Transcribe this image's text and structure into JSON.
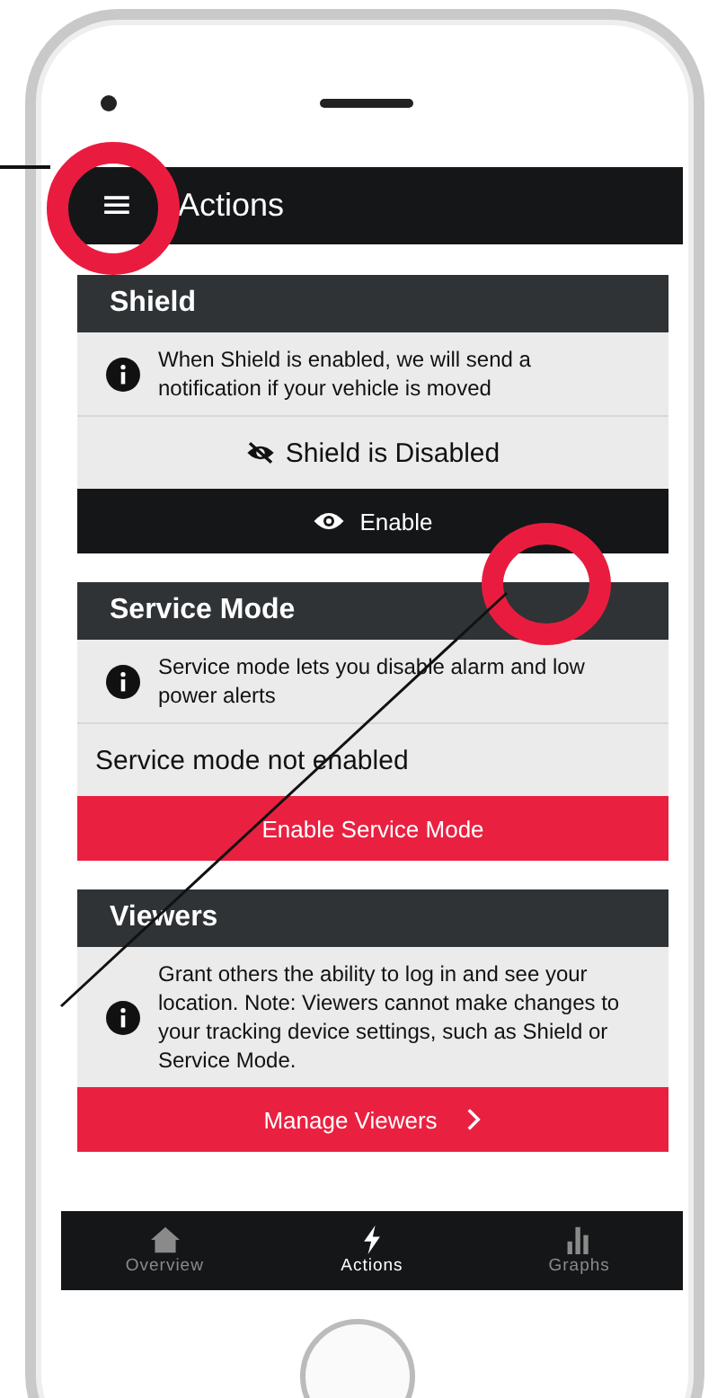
{
  "app_bar": {
    "menu_icon": "≡",
    "title": "Actions"
  },
  "sections": [
    {
      "title": "Shield",
      "info": "When Shield is enabled, we will send a notification if your vehicle is moved",
      "status": {
        "text": "Shield is Disabled",
        "kind": "icon"
      },
      "button": {
        "label": "Enable",
        "kind": "dark"
      }
    },
    {
      "title": "Service Mode",
      "info": "Service mode lets you disable alarm and low power alerts",
      "status": {
        "text": "Service mode not enabled",
        "kind": "plain"
      },
      "button": {
        "label": "Enable Service Mode",
        "kind": "red"
      }
    },
    {
      "title": "Viewers",
      "info": "Grant others the ability to log in and see your location. Note: Viewers cannot make changes to your tracking device settings, such as Shield or Service Mode.",
      "button": {
        "label": "Manage Viewers",
        "kind": "red-chevron"
      }
    }
  ],
  "bottom_nav": [
    {
      "label": "Overview",
      "selected": false
    },
    {
      "label": "Actions",
      "selected": true
    },
    {
      "label": "Graphs",
      "selected": false
    }
  ]
}
